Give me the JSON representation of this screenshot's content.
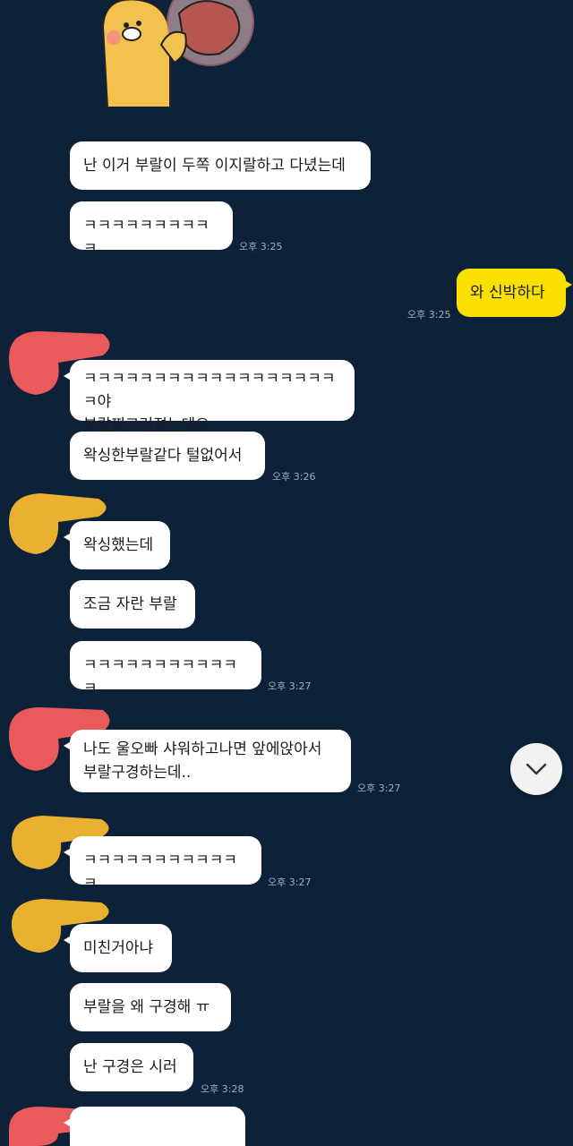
{
  "messages": [
    {
      "text": "난 이거 부랄이 두쪽 이지랄하고 다녔는데"
    },
    {
      "text": "ㅋㅋㅋㅋㅋㅋㅋㅋㅋㅋ",
      "time": "오후 3:25"
    },
    {
      "text": "와 신박하다",
      "time": "오후 3:25"
    },
    {
      "text": "ㅋㅋㅋㅋㅋㅋㅋㅋㅋㅋㅋㅋㅋㅋㅋㅋㅋㅋㅋ야\n부랄찌그러졌는데요"
    },
    {
      "text": "왁싱한부랄같다 털없어서",
      "time": "오후 3:26"
    },
    {
      "text": "왁싱했는데"
    },
    {
      "text": "조금 자란 부랄"
    },
    {
      "text": "ㅋㅋㅋㅋㅋㅋㅋㅋㅋㅋㅋㅋ",
      "time": "오후 3:27"
    },
    {
      "text": "나도 울오빠 샤워하고나면 앞에앉아서\n부랄구경하는데..",
      "time": "오후 3:27"
    },
    {
      "text": "ㅋㅋㅋㅋㅋㅋㅋㅋㅋㅋㅋㅋ",
      "time": "오후 3:27"
    },
    {
      "text": "미친거아냐"
    },
    {
      "text": "부랄을 왜 구경해 ㅠ"
    },
    {
      "text": "난 구경은 시러",
      "time": "오후 3:28"
    }
  ],
  "colors": {
    "background": "#0d2238",
    "incoming_bubble": "#ffffff",
    "outgoing_bubble": "#f9e000",
    "avatar_red": "#ea5a5a",
    "avatar_yellow": "#e9b12f"
  },
  "icons": {
    "scroll_down": "chevron-down-icon",
    "sticker": "lion-character-sticker"
  }
}
